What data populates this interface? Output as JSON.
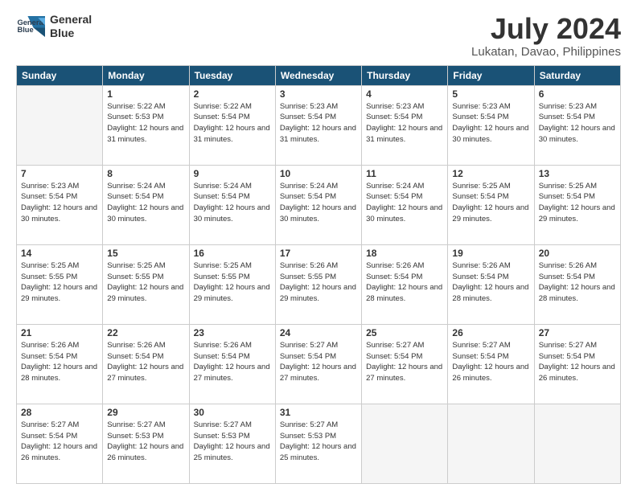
{
  "header": {
    "logo_line1": "General",
    "logo_line2": "Blue",
    "month": "July 2024",
    "location": "Lukatan, Davao, Philippines"
  },
  "columns": [
    "Sunday",
    "Monday",
    "Tuesday",
    "Wednesday",
    "Thursday",
    "Friday",
    "Saturday"
  ],
  "weeks": [
    [
      {
        "day": "",
        "sunrise": "",
        "sunset": "",
        "daylight": ""
      },
      {
        "day": "1",
        "sunrise": "Sunrise: 5:22 AM",
        "sunset": "Sunset: 5:53 PM",
        "daylight": "Daylight: 12 hours and 31 minutes."
      },
      {
        "day": "2",
        "sunrise": "Sunrise: 5:22 AM",
        "sunset": "Sunset: 5:54 PM",
        "daylight": "Daylight: 12 hours and 31 minutes."
      },
      {
        "day": "3",
        "sunrise": "Sunrise: 5:23 AM",
        "sunset": "Sunset: 5:54 PM",
        "daylight": "Daylight: 12 hours and 31 minutes."
      },
      {
        "day": "4",
        "sunrise": "Sunrise: 5:23 AM",
        "sunset": "Sunset: 5:54 PM",
        "daylight": "Daylight: 12 hours and 31 minutes."
      },
      {
        "day": "5",
        "sunrise": "Sunrise: 5:23 AM",
        "sunset": "Sunset: 5:54 PM",
        "daylight": "Daylight: 12 hours and 30 minutes."
      },
      {
        "day": "6",
        "sunrise": "Sunrise: 5:23 AM",
        "sunset": "Sunset: 5:54 PM",
        "daylight": "Daylight: 12 hours and 30 minutes."
      }
    ],
    [
      {
        "day": "7",
        "sunrise": "Sunrise: 5:23 AM",
        "sunset": "Sunset: 5:54 PM",
        "daylight": "Daylight: 12 hours and 30 minutes."
      },
      {
        "day": "8",
        "sunrise": "Sunrise: 5:24 AM",
        "sunset": "Sunset: 5:54 PM",
        "daylight": "Daylight: 12 hours and 30 minutes."
      },
      {
        "day": "9",
        "sunrise": "Sunrise: 5:24 AM",
        "sunset": "Sunset: 5:54 PM",
        "daylight": "Daylight: 12 hours and 30 minutes."
      },
      {
        "day": "10",
        "sunrise": "Sunrise: 5:24 AM",
        "sunset": "Sunset: 5:54 PM",
        "daylight": "Daylight: 12 hours and 30 minutes."
      },
      {
        "day": "11",
        "sunrise": "Sunrise: 5:24 AM",
        "sunset": "Sunset: 5:54 PM",
        "daylight": "Daylight: 12 hours and 30 minutes."
      },
      {
        "day": "12",
        "sunrise": "Sunrise: 5:25 AM",
        "sunset": "Sunset: 5:54 PM",
        "daylight": "Daylight: 12 hours and 29 minutes."
      },
      {
        "day": "13",
        "sunrise": "Sunrise: 5:25 AM",
        "sunset": "Sunset: 5:54 PM",
        "daylight": "Daylight: 12 hours and 29 minutes."
      }
    ],
    [
      {
        "day": "14",
        "sunrise": "Sunrise: 5:25 AM",
        "sunset": "Sunset: 5:55 PM",
        "daylight": "Daylight: 12 hours and 29 minutes."
      },
      {
        "day": "15",
        "sunrise": "Sunrise: 5:25 AM",
        "sunset": "Sunset: 5:55 PM",
        "daylight": "Daylight: 12 hours and 29 minutes."
      },
      {
        "day": "16",
        "sunrise": "Sunrise: 5:25 AM",
        "sunset": "Sunset: 5:55 PM",
        "daylight": "Daylight: 12 hours and 29 minutes."
      },
      {
        "day": "17",
        "sunrise": "Sunrise: 5:26 AM",
        "sunset": "Sunset: 5:55 PM",
        "daylight": "Daylight: 12 hours and 29 minutes."
      },
      {
        "day": "18",
        "sunrise": "Sunrise: 5:26 AM",
        "sunset": "Sunset: 5:54 PM",
        "daylight": "Daylight: 12 hours and 28 minutes."
      },
      {
        "day": "19",
        "sunrise": "Sunrise: 5:26 AM",
        "sunset": "Sunset: 5:54 PM",
        "daylight": "Daylight: 12 hours and 28 minutes."
      },
      {
        "day": "20",
        "sunrise": "Sunrise: 5:26 AM",
        "sunset": "Sunset: 5:54 PM",
        "daylight": "Daylight: 12 hours and 28 minutes."
      }
    ],
    [
      {
        "day": "21",
        "sunrise": "Sunrise: 5:26 AM",
        "sunset": "Sunset: 5:54 PM",
        "daylight": "Daylight: 12 hours and 28 minutes."
      },
      {
        "day": "22",
        "sunrise": "Sunrise: 5:26 AM",
        "sunset": "Sunset: 5:54 PM",
        "daylight": "Daylight: 12 hours and 27 minutes."
      },
      {
        "day": "23",
        "sunrise": "Sunrise: 5:26 AM",
        "sunset": "Sunset: 5:54 PM",
        "daylight": "Daylight: 12 hours and 27 minutes."
      },
      {
        "day": "24",
        "sunrise": "Sunrise: 5:27 AM",
        "sunset": "Sunset: 5:54 PM",
        "daylight": "Daylight: 12 hours and 27 minutes."
      },
      {
        "day": "25",
        "sunrise": "Sunrise: 5:27 AM",
        "sunset": "Sunset: 5:54 PM",
        "daylight": "Daylight: 12 hours and 27 minutes."
      },
      {
        "day": "26",
        "sunrise": "Sunrise: 5:27 AM",
        "sunset": "Sunset: 5:54 PM",
        "daylight": "Daylight: 12 hours and 26 minutes."
      },
      {
        "day": "27",
        "sunrise": "Sunrise: 5:27 AM",
        "sunset": "Sunset: 5:54 PM",
        "daylight": "Daylight: 12 hours and 26 minutes."
      }
    ],
    [
      {
        "day": "28",
        "sunrise": "Sunrise: 5:27 AM",
        "sunset": "Sunset: 5:54 PM",
        "daylight": "Daylight: 12 hours and 26 minutes."
      },
      {
        "day": "29",
        "sunrise": "Sunrise: 5:27 AM",
        "sunset": "Sunset: 5:53 PM",
        "daylight": "Daylight: 12 hours and 26 minutes."
      },
      {
        "day": "30",
        "sunrise": "Sunrise: 5:27 AM",
        "sunset": "Sunset: 5:53 PM",
        "daylight": "Daylight: 12 hours and 25 minutes."
      },
      {
        "day": "31",
        "sunrise": "Sunrise: 5:27 AM",
        "sunset": "Sunset: 5:53 PM",
        "daylight": "Daylight: 12 hours and 25 minutes."
      },
      {
        "day": "",
        "sunrise": "",
        "sunset": "",
        "daylight": ""
      },
      {
        "day": "",
        "sunrise": "",
        "sunset": "",
        "daylight": ""
      },
      {
        "day": "",
        "sunrise": "",
        "sunset": "",
        "daylight": ""
      }
    ]
  ]
}
